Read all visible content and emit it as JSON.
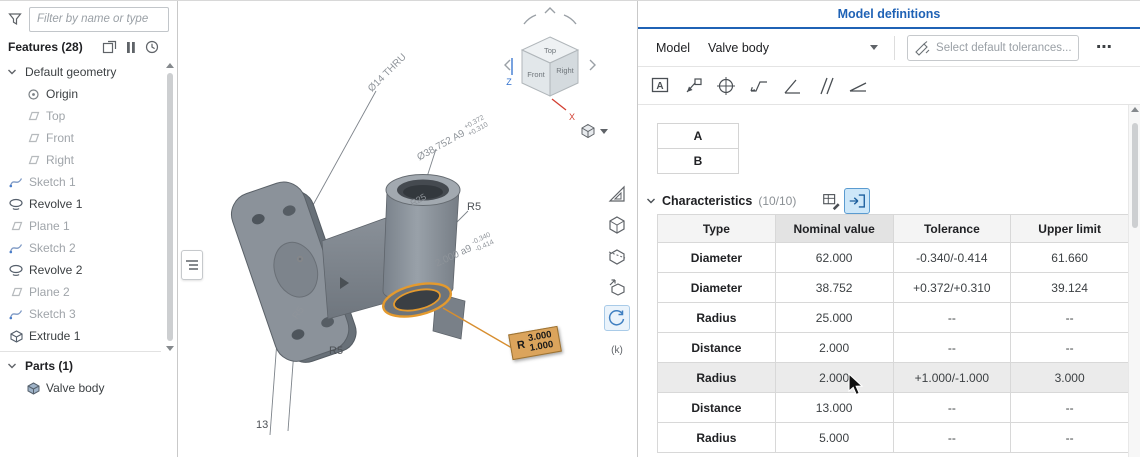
{
  "sidebar": {
    "filter_placeholder": "Filter by name or type",
    "features_header": "Features (28)",
    "tree": [
      {
        "label": "Default geometry",
        "icon": "chevron-down",
        "muted": false,
        "indent": 0
      },
      {
        "label": "Origin",
        "icon": "origin",
        "muted": false,
        "indent": 1
      },
      {
        "label": "Top",
        "icon": "plane",
        "muted": true,
        "indent": 1
      },
      {
        "label": "Front",
        "icon": "plane",
        "muted": true,
        "indent": 1
      },
      {
        "label": "Right",
        "icon": "plane",
        "muted": true,
        "indent": 1
      },
      {
        "label": "Sketch 1",
        "icon": "sketch",
        "muted": true,
        "indent": 0
      },
      {
        "label": "Revolve 1",
        "icon": "revolve",
        "muted": false,
        "indent": 0
      },
      {
        "label": "Plane 1",
        "icon": "plane",
        "muted": true,
        "indent": 0
      },
      {
        "label": "Sketch 2",
        "icon": "sketch",
        "muted": true,
        "indent": 0
      },
      {
        "label": "Revolve 2",
        "icon": "revolve",
        "muted": false,
        "indent": 0
      },
      {
        "label": "Plane 2",
        "icon": "plane",
        "muted": true,
        "indent": 0
      },
      {
        "label": "Sketch 3",
        "icon": "sketch",
        "muted": true,
        "indent": 0
      },
      {
        "label": "Extrude 1",
        "icon": "extrude",
        "muted": false,
        "indent": 0
      }
    ],
    "parts_header": "Parts (1)",
    "part_label": "Valve body"
  },
  "viewport": {
    "view_cube": {
      "top": "Top",
      "front": "Front",
      "right": "Right",
      "z": "Z",
      "x": "X"
    },
    "annotations": {
      "dim_diameter_thru": "Ø14 THRU",
      "dim_diameter_38": "Ø38.752 A9",
      "dim_diameter_38_upper": "+0.372",
      "dim_diameter_38_lower": "+0.310",
      "dim_r25": "R25",
      "dim_r5_top": "R5",
      "dim_2000": "2.000 a9",
      "dim_2000_upper": "-0.340",
      "dim_2000_lower": "-0.414",
      "dim_r5_flange": "R5",
      "dim_r5_bottom": "R5",
      "dim_13": "13"
    },
    "highlight_tag": {
      "prefix": "R",
      "top": "3.000",
      "bottom": "1.000"
    },
    "shortcut_icon_label": "(k)"
  },
  "panel": {
    "title": "Model definitions",
    "model_label": "Model",
    "model_value": "Valve body",
    "tolerance_placeholder": "Select default tolerances...",
    "more_label": "⋯",
    "datums": [
      "A",
      "B"
    ],
    "datum_icon_glyph": "A",
    "characteristics": {
      "title": "Characteristics",
      "count": "(10/10)"
    },
    "table": {
      "columns": [
        "Type",
        "Nominal value",
        "Tolerance",
        "Upper limit"
      ],
      "rows": [
        [
          "Diameter",
          "62.000",
          "-0.340/-0.414",
          "61.660"
        ],
        [
          "Diameter",
          "38.752",
          "+0.372/+0.310",
          "39.124"
        ],
        [
          "Radius",
          "25.000",
          "--",
          "--"
        ],
        [
          "Distance",
          "2.000",
          "--",
          "--"
        ],
        [
          "Radius",
          "2.000",
          "+1.000/-1.000",
          "3.000"
        ],
        [
          "Distance",
          "13.000",
          "--",
          "--"
        ],
        [
          "Radius",
          "5.000",
          "--",
          "--"
        ]
      ],
      "highlighted_row": 4
    }
  },
  "colors": {
    "accent_blue": "#1f62b5",
    "highlight_orange": "#e49a2e",
    "selected_icon_bg": "#cde7f9"
  }
}
